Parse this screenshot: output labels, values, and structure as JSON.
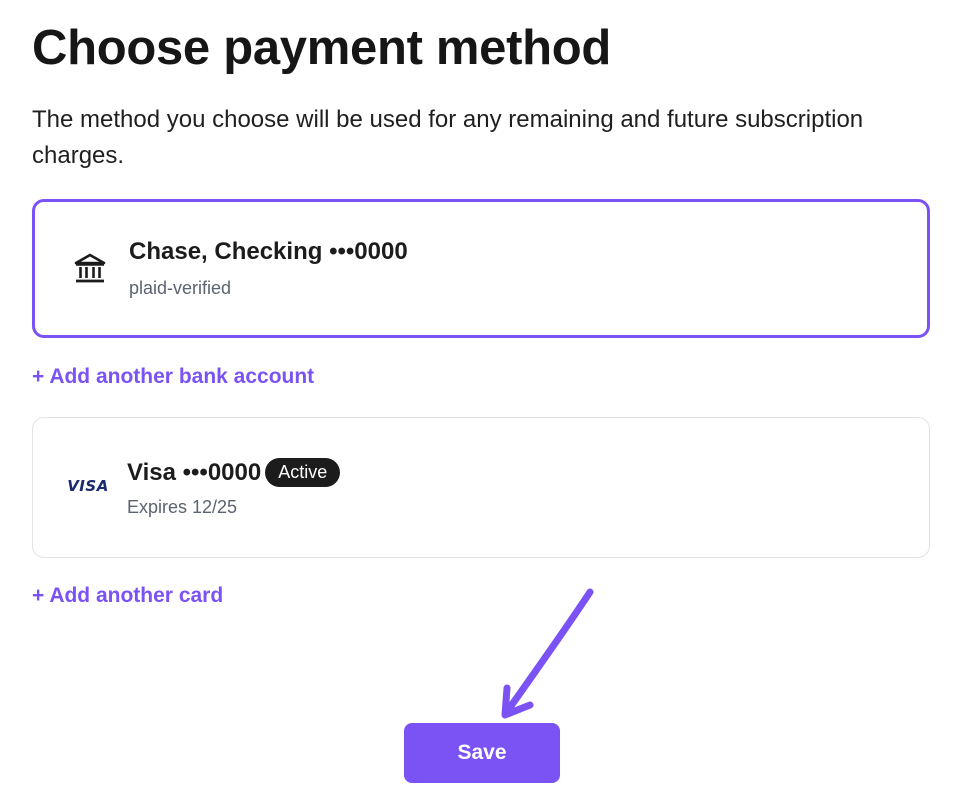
{
  "header": {
    "title": "Choose payment method",
    "description": "The method you choose will be used for any remaining and future subscription charges."
  },
  "methods": [
    {
      "icon": "bank-icon",
      "name": "Chase, Checking •••0000",
      "sub": "plaid-verified",
      "selected": true
    },
    {
      "icon": "visa-logo",
      "logo_text": "VISA",
      "name": "Visa •••0000",
      "badge": "Active",
      "sub": "Expires 12/25",
      "selected": false
    }
  ],
  "links": {
    "add_bank": "+ Add another bank account",
    "add_card": "+ Add another card"
  },
  "actions": {
    "save_label": "Save"
  },
  "colors": {
    "accent": "#7b52f4",
    "badge_bg": "#1c1c1c",
    "border": "#e3e3e6"
  }
}
